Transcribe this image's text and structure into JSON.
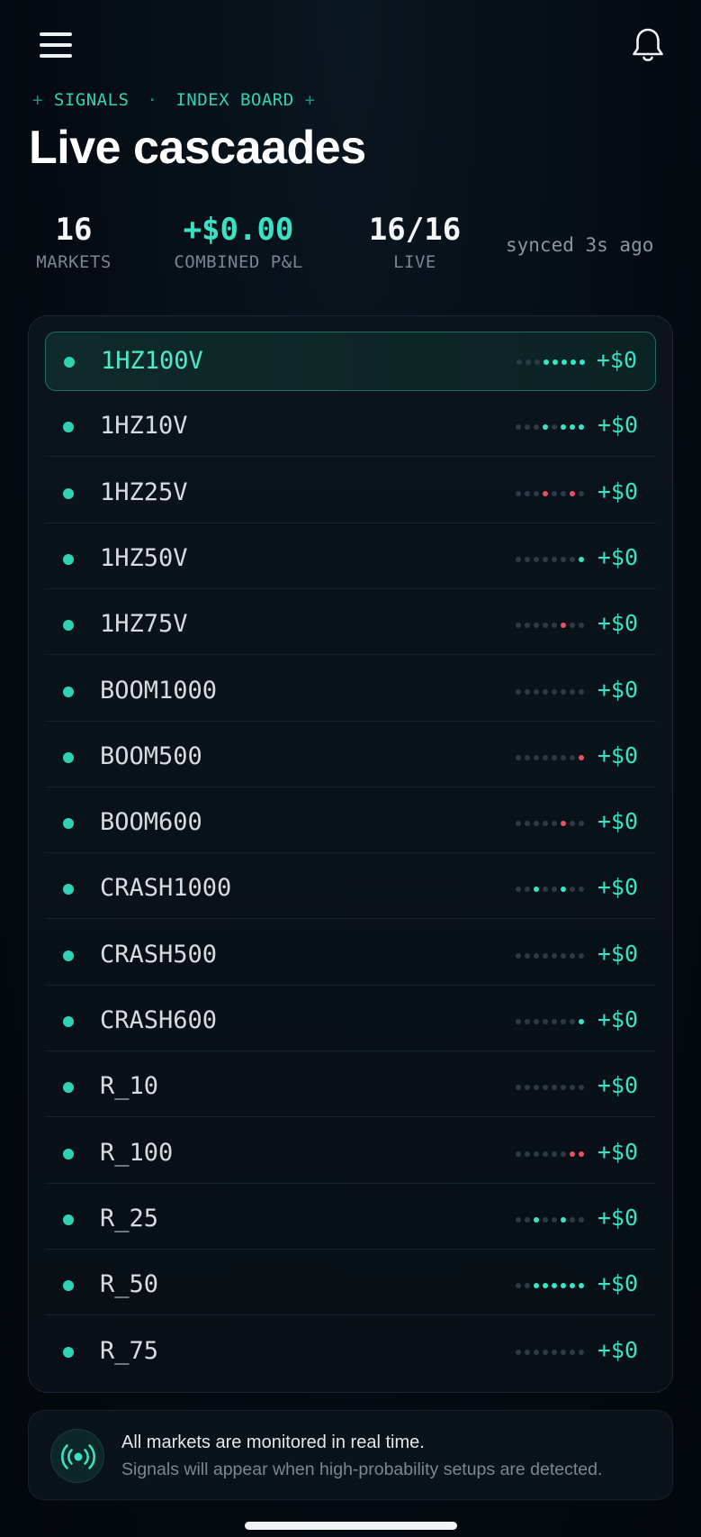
{
  "breadcrumb": {
    "left_mark": "+",
    "section": "SIGNALS",
    "separator": "·",
    "page": "INDEX BOARD",
    "right_mark": "+"
  },
  "title": "Live cascaades",
  "stats": {
    "markets": {
      "value": "16",
      "label": "MARKETS"
    },
    "pnl": {
      "value": "+$0.00",
      "label": "COMBINED P&L"
    },
    "live": {
      "value": "16/16",
      "label": "LIVE"
    },
    "synced": "synced 3s ago"
  },
  "markets": [
    {
      "name": "1HZ100V",
      "pnl": "+$0",
      "active": true,
      "spark": "nnnuuuuu"
    },
    {
      "name": "1HZ10V",
      "pnl": "+$0",
      "active": false,
      "spark": "nnnunuuu"
    },
    {
      "name": "1HZ25V",
      "pnl": "+$0",
      "active": false,
      "spark": "nnndnndn"
    },
    {
      "name": "1HZ50V",
      "pnl": "+$0",
      "active": false,
      "spark": "nnnnnnnu"
    },
    {
      "name": "1HZ75V",
      "pnl": "+$0",
      "active": false,
      "spark": "nnnnndnn"
    },
    {
      "name": "BOOM1000",
      "pnl": "+$0",
      "active": false,
      "spark": "nnnnnnnn"
    },
    {
      "name": "BOOM500",
      "pnl": "+$0",
      "active": false,
      "spark": "nnnnnnnd"
    },
    {
      "name": "BOOM600",
      "pnl": "+$0",
      "active": false,
      "spark": "nnnnndnn"
    },
    {
      "name": "CRASH1000",
      "pnl": "+$0",
      "active": false,
      "spark": "nnunnunn"
    },
    {
      "name": "CRASH500",
      "pnl": "+$0",
      "active": false,
      "spark": "nnnnnnnn"
    },
    {
      "name": "CRASH600",
      "pnl": "+$0",
      "active": false,
      "spark": "nnnnnnnu"
    },
    {
      "name": "R_10",
      "pnl": "+$0",
      "active": false,
      "spark": "nnnnnnnn"
    },
    {
      "name": "R_100",
      "pnl": "+$0",
      "active": false,
      "spark": "nnnnnndd"
    },
    {
      "name": "R_25",
      "pnl": "+$0",
      "active": false,
      "spark": "nnunnunn"
    },
    {
      "name": "R_50",
      "pnl": "+$0",
      "active": false,
      "spark": "nnuuuuuu"
    },
    {
      "name": "R_75",
      "pnl": "+$0",
      "active": false,
      "spark": "nnnnnnnn"
    }
  ],
  "info": {
    "icon": "broadcast-icon",
    "line1": "All markets are monitored in real time.",
    "line2": "Signals will appear when high-probability setups are detected."
  },
  "colors": {
    "accent": "#39e2c2",
    "down": "#ec4f61",
    "background": "#050b12"
  }
}
